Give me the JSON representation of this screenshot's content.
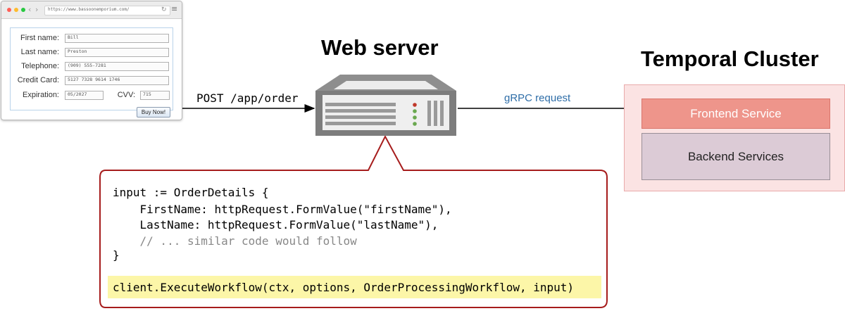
{
  "browser": {
    "url": "https://www.bassoonemporium.com/",
    "fields": [
      {
        "label": "First name:",
        "value": "Bill"
      },
      {
        "label": "Last name:",
        "value": "Preston"
      },
      {
        "label": "Telephone:",
        "value": "(909) 555-7281"
      },
      {
        "label": "Credit Card:",
        "value": "5127 7328 9614 1746"
      }
    ],
    "expiration": {
      "label": "Expiration:",
      "value": "05/2027"
    },
    "cvv": {
      "label": "CVV:",
      "value": "715"
    },
    "buy_button": "Buy Now!"
  },
  "request_label": "POST /app/order",
  "web_server_title": "Web server",
  "grpc_label": "gRPC request",
  "cluster": {
    "title": "Temporal Cluster",
    "frontend": "Frontend Service",
    "backend": "Backend Services"
  },
  "code": {
    "line1": "input := OrderDetails {",
    "line2": "    FirstName: httpRequest.FormValue(\"firstName\"),",
    "line3": "    LastName: httpRequest.FormValue(\"lastName\"),",
    "line4": "    // ... similar code would follow",
    "line5": "}",
    "line6": "client.ExecuteWorkflow(ctx, options, OrderProcessingWorkflow, input)"
  },
  "colors": {
    "grpc_text": "#2f6ea8",
    "callout_border": "#a61c1c",
    "frontend_fill": "#ee958b",
    "backend_fill": "#dccbd6",
    "cluster_fill": "#fbe3e3",
    "highlight": "#fcf6a8"
  }
}
